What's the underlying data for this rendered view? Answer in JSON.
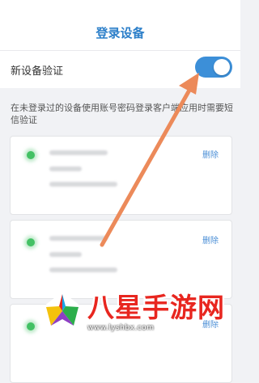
{
  "header": {
    "title": "登录设备"
  },
  "new_device_verification": {
    "label": "新设备验证",
    "enabled": true
  },
  "description": "在未登录过的设备使用账号密码登录客户端应用时需要短信验证",
  "devices": [
    {
      "delete_label": "删除"
    },
    {
      "delete_label": "删除"
    },
    {
      "delete_label": "删除"
    }
  ],
  "watermark": {
    "text": "八星手游网",
    "url": "www.lyshbx.com"
  },
  "colors": {
    "accent": "#2c7fc9",
    "toggle_on": "#3c8fd8",
    "online_dot": "#43c164",
    "annotation_arrow": "#ec8a5a",
    "watermark": "#e8261f"
  }
}
